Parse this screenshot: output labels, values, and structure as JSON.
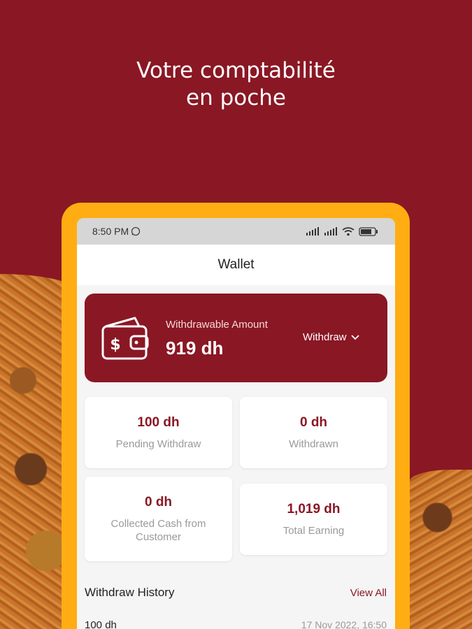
{
  "headline": {
    "line1": "Votre comptabilité",
    "line2": "en poche"
  },
  "status_bar": {
    "time": "8:50 PM"
  },
  "app_bar": {
    "title": "Wallet"
  },
  "wallet": {
    "label": "Withdrawable Amount",
    "amount": "919 dh",
    "withdraw_label": "Withdraw"
  },
  "stats": [
    {
      "value": "100 dh",
      "label": "Pending Withdraw"
    },
    {
      "value": "0 dh",
      "label": "Withdrawn"
    },
    {
      "value": "0 dh",
      "label_line1": "Collected Cash from",
      "label_line2": "Customer"
    },
    {
      "value": "1,019 dh",
      "label": "Total Earning"
    }
  ],
  "history": {
    "title": "Withdraw History",
    "view_all": "View All",
    "first_amount": "100 dh",
    "first_date": "17 Nov 2022, 16:50"
  },
  "colors": {
    "brand": "#8a1724",
    "frame": "#ffad13"
  }
}
